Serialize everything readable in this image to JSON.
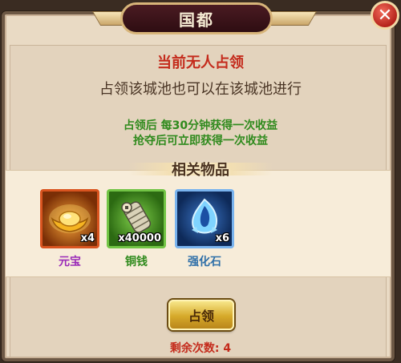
{
  "dialog": {
    "title": "国都",
    "close_label": "✕"
  },
  "status": {
    "headline": "当前无人占领",
    "description": "占领该城池也可以在该城池进行",
    "reward_line_1": "占领后 每30分钟获得一次收益",
    "reward_line_2": "抢夺后可立即获得一次收益"
  },
  "items_section": {
    "header": "相关物品",
    "items": [
      {
        "name": "元宝",
        "count": "x4",
        "icon": "gold-ingot-icon"
      },
      {
        "name": "铜钱",
        "count": "x40000",
        "icon": "copper-coins-icon"
      },
      {
        "name": "强化石",
        "count": "x6",
        "icon": "enhance-stone-icon"
      }
    ]
  },
  "actions": {
    "occupy_label": "占领",
    "remaining_text": "剩余次数: 4"
  },
  "colors": {
    "headline": "#c42b1c",
    "reward_text": "#2f8a1d",
    "title_plate": "#3a141a"
  }
}
